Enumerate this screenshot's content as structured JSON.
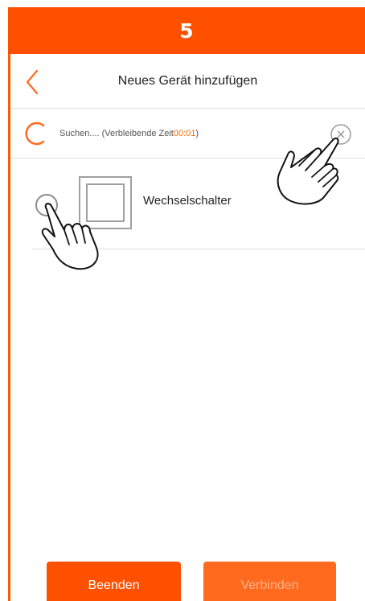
{
  "step": {
    "number": "5"
  },
  "header": {
    "title": "Neues Gerät hinzufügen",
    "back_icon": "chevron-left-icon"
  },
  "search": {
    "text": "Suchen.... (Verbleibende Zeit ",
    "time": "00:01",
    "suffix": ")",
    "spinner_icon": "loading-spinner-icon",
    "cancel_icon": "close-circle-icon"
  },
  "devices": [
    {
      "name": "Wechselschalter",
      "icon": "switch-icon",
      "selected": false
    }
  ],
  "footer": {
    "finish_label": "Beenden",
    "connect_label": "Verbinden"
  },
  "colors": {
    "accent": "#ff5000",
    "disabled_text": "#ffb48a",
    "timer": "#ff6a00"
  }
}
